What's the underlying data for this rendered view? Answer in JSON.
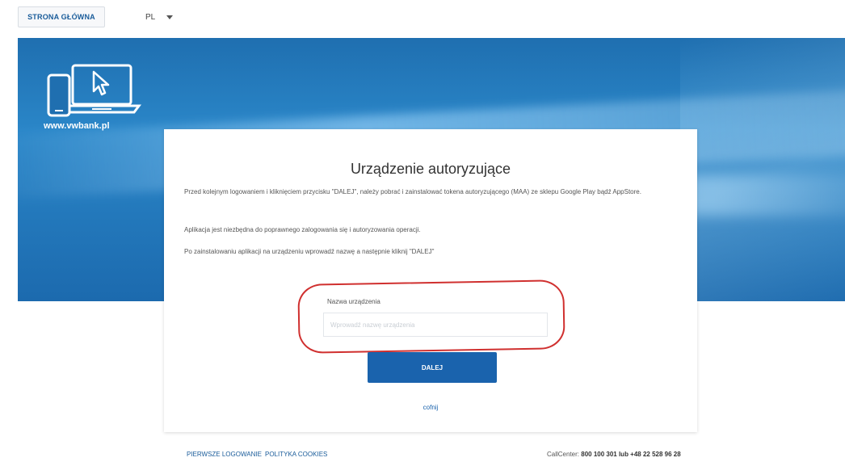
{
  "topbar": {
    "home_label": "STRONA GŁÓWNA",
    "lang_label": "PL"
  },
  "banner": {
    "logo_text": "www.vwbank.pl"
  },
  "modal": {
    "title": "Urządzenie autoryzujące",
    "paragraph1": "Przed kolejnym logowaniem i kliknięciem przycisku \"DALEJ\", należy pobrać i zainstalować tokena autoryzującego (MAA) ze sklepu Google Play bądź AppStore.",
    "paragraph2": "Aplikacja jest niezbędna do poprawnego zalogowania się i autoryzowania operacji.",
    "paragraph3": "Po zainstalowaniu aplikacji na urządzeniu wprowadź nazwę a następnie kliknij \"DALEJ\"",
    "field_label": "Nazwa urządzenia",
    "field_placeholder": "Wprowadź nazwę urządzenia",
    "field_value": "",
    "next_label": "DALEJ",
    "back_label": "cofnij"
  },
  "footer": {
    "link1": "PIERWSZE LOGOWANIE",
    "link2": "POLITYKA COOKIES",
    "callcenter_prefix": "CallCenter:",
    "callcenter_numbers": "800 100 301 lub +48 22 528 96 28"
  },
  "colors": {
    "accent": "#1a63ad",
    "highlight": "#d0302f"
  }
}
